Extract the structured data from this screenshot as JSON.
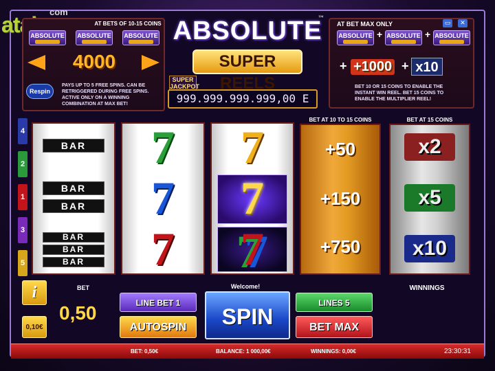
{
  "logo": {
    "main": "atalog",
    "suffix": "com"
  },
  "left_panel": {
    "title": "AT BETS OF 10-15 COINS",
    "logo_word": "ABSOLUTE",
    "value": "4000",
    "respin": "Respin",
    "text": [
      "PAYS UP TO 5 FREE SPINS. CAN BE",
      "RETRIGGERED DURING FREE SPINS.",
      "ACTIVE ONLY ON A WINNING",
      "COMBINATION AT MAX BET!"
    ]
  },
  "title": {
    "word1": "ABSOLUTE",
    "word2": "SUPER REELS",
    "tm": "™",
    "super": "SUPER",
    "jackpot_label": "JACKPOT",
    "jackpot_value": "999.999.999.999,00 E"
  },
  "right_panel": {
    "title": "AT BET MAX ONLY",
    "logo_word": "ABSOLUTE",
    "plus1": "+",
    "plus2": "+",
    "value": "+1000",
    "plus3": "+",
    "mult": "x10",
    "text": [
      "BET 10 OR 15 COINS TO ENABLE THE",
      "INSTANT WIN REEL. BET 15 COINS TO",
      "ENABLE THE MULTIPLIER REEL!"
    ]
  },
  "window_controls": {
    "minimize": "▭",
    "close": "✕"
  },
  "side_numbers": [
    "4",
    "2",
    "1",
    "3",
    "5"
  ],
  "reels": {
    "reel1": [
      "BAR",
      "BAR",
      "BAR",
      "BAR",
      "BAR",
      "BAR"
    ],
    "reel2": [
      "7",
      "7",
      "7"
    ],
    "reel3": [
      "7",
      "7",
      "7"
    ]
  },
  "instant_reel": {
    "title": "BET AT 10 TO 15 COINS",
    "prizes": [
      "+50",
      "+150",
      "+750"
    ]
  },
  "mult_reel": {
    "title": "BET AT 15 COINS",
    "values": [
      "x2",
      "x5",
      "x10"
    ]
  },
  "controls": {
    "info": "i",
    "coin": "0,10€",
    "bet_label": "BET",
    "bet_value": "0,50",
    "line_bet": "LINE BET 1",
    "autospin": "AUTOSPIN",
    "welcome": "Welcome!",
    "spin": "SPIN",
    "lines": "LINES 5",
    "bet_max": "BET MAX",
    "winnings_label": "WINNINGS"
  },
  "status_bar": {
    "bet": "BET: 0,50€",
    "balance": "BALANCE: 1 000,00€",
    "winnings": "WINNINGS: 0,00€",
    "time": "23:30:31"
  },
  "colors": {
    "gold": "#ffb627",
    "purple": "#6a3ad0",
    "red": "#c2141a",
    "green": "#2aa03a",
    "blue": "#1a56d8"
  }
}
